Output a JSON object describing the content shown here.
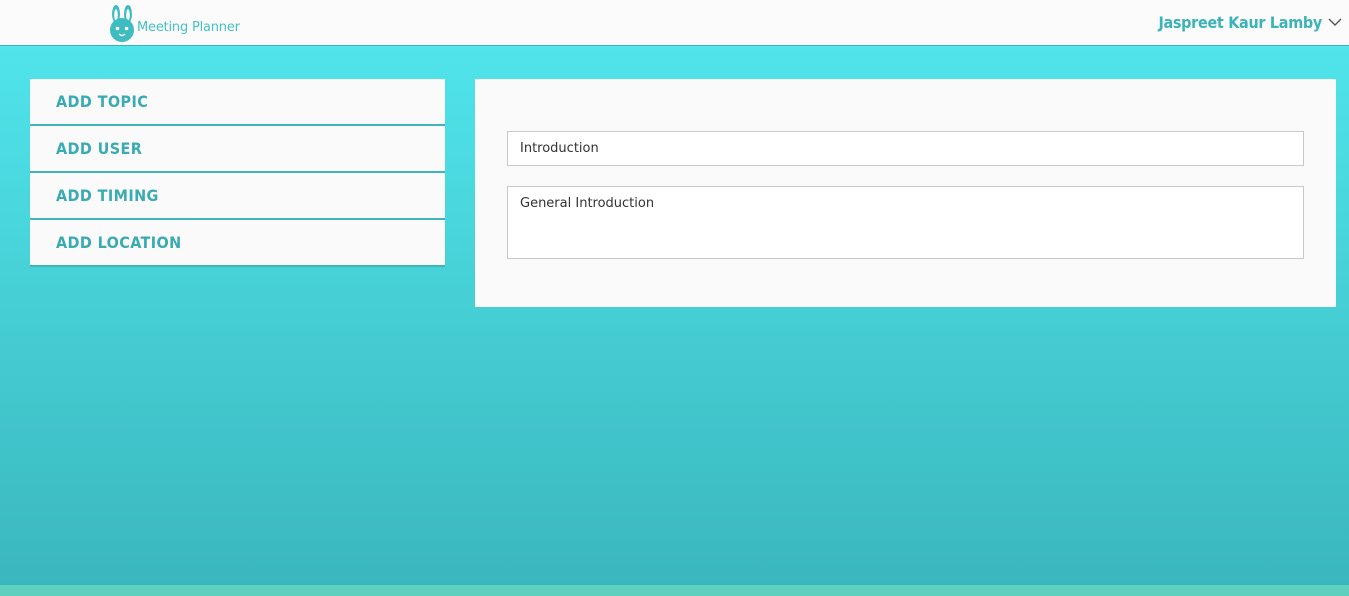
{
  "header": {
    "app_name": "Meeting Planner",
    "logo_icon": "bunny-logo-icon",
    "user_name": "Jaspreet Kaur Lamby",
    "user_menu_icon": "chevron-down-icon"
  },
  "sidebar": {
    "items": [
      {
        "label": "ADD TOPIC"
      },
      {
        "label": "ADD USER"
      },
      {
        "label": "ADD TIMING"
      },
      {
        "label": "ADD LOCATION"
      }
    ]
  },
  "form": {
    "topic_value": "Introduction",
    "description_value": "General Introduction"
  },
  "footer": {
    "left_text": "",
    "right_text": ""
  },
  "colors": {
    "accent": "#3bb3b8",
    "background_top": "#52e8ef",
    "background_bottom": "#3ab6bd",
    "panel": "#fafafa"
  }
}
